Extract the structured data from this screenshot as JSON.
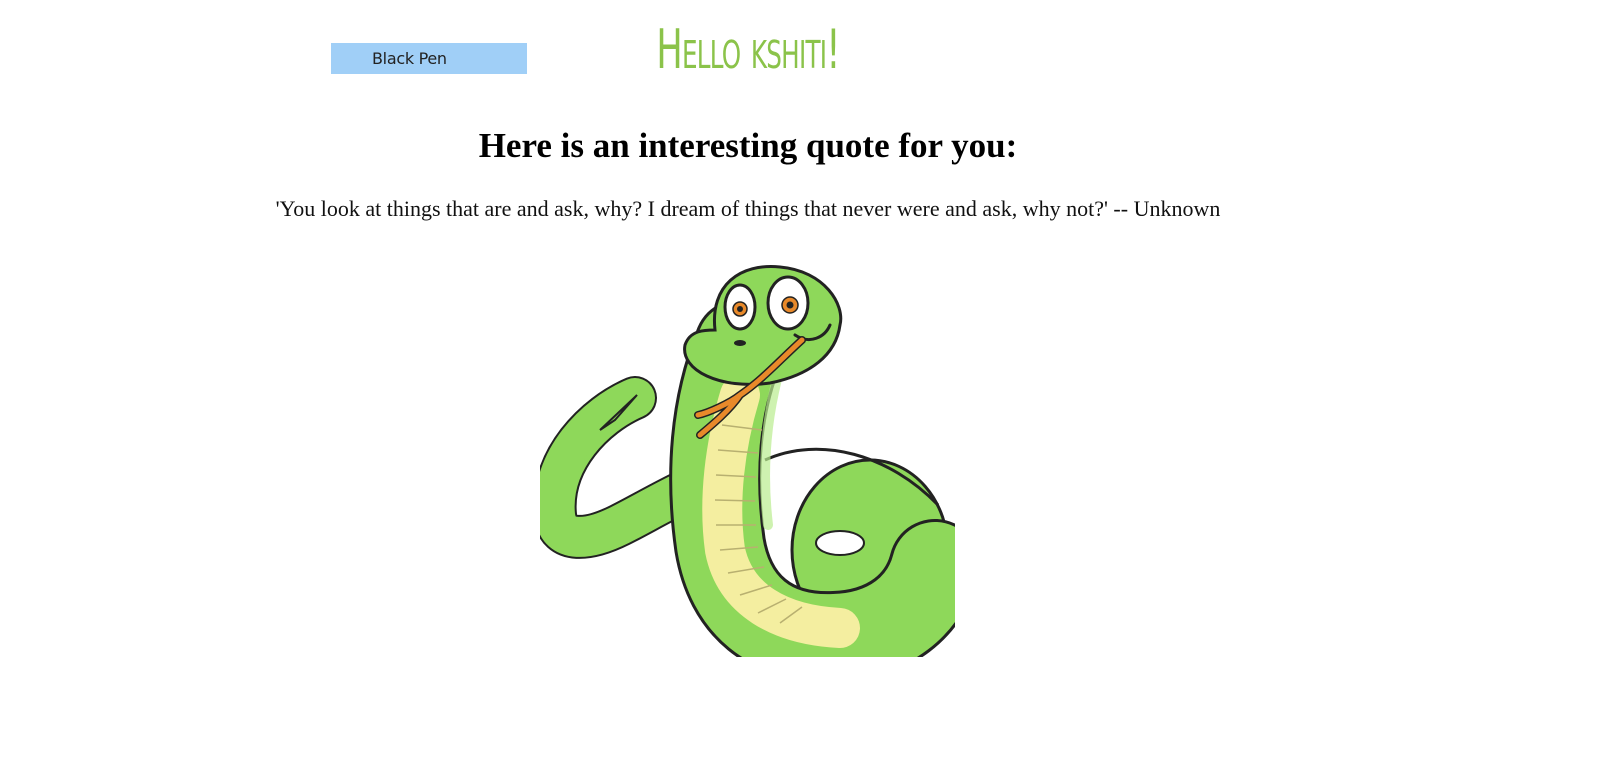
{
  "pen_selector": {
    "selected": "Black Pen"
  },
  "greeting": {
    "text": "Hello kshiti!"
  },
  "quote": {
    "heading": "Here is an interesting quote for you:",
    "text": "'You look at things that are and ask, why? I dream of things that never were and ask, why not?' -- Unknown"
  },
  "colors": {
    "greeting": "#8bc34a",
    "pen_selector_bg": "#a0cff7",
    "snake_body": "#8ed85a",
    "snake_belly": "#f4eea0",
    "snake_tongue": "#e8892a"
  },
  "illustration": {
    "icon": "snake-illustration"
  }
}
